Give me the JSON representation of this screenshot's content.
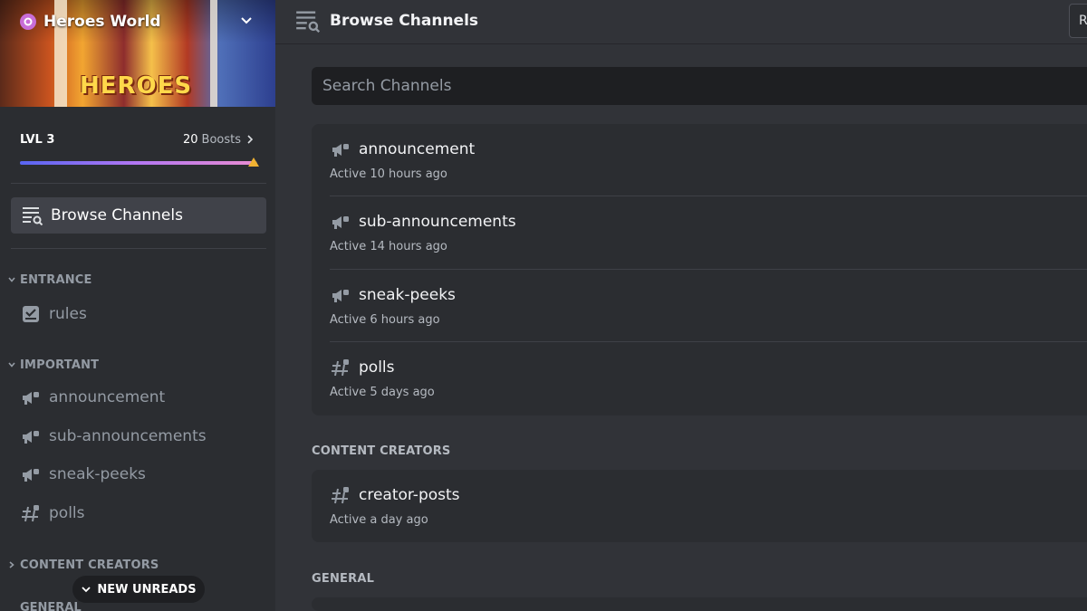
{
  "server": {
    "name": "Heroes World",
    "banner_text": "HEROES",
    "level": "LVL 3",
    "boost_count": "20",
    "boost_label": "Boosts",
    "boost_progress": 0.98
  },
  "sidebar": {
    "browse_label": "Browse Channels",
    "categories": [
      {
        "name": "ENTRANCE",
        "channels": [
          {
            "name": "rules",
            "icon": "rules-icon"
          }
        ]
      },
      {
        "name": "IMPORTANT",
        "channels": [
          {
            "name": "announcement",
            "icon": "announcement-icon"
          },
          {
            "name": "sub-announcements",
            "icon": "announcement-icon"
          },
          {
            "name": "sneak-peeks",
            "icon": "announcement-icon"
          },
          {
            "name": "polls",
            "icon": "hashtag-icon"
          }
        ]
      },
      {
        "name": "CONTENT CREATORS",
        "channels": []
      }
    ],
    "new_unreads": "NEW UNREADS",
    "cut_category": "GENERAL"
  },
  "main": {
    "title": "Browse Channels",
    "right_button": "R",
    "search_placeholder": "Search Channels",
    "groups": [
      {
        "category": "",
        "channels": [
          {
            "name": "announcement",
            "activity": "Active 10 hours ago",
            "icon": "announcement-icon"
          },
          {
            "name": "sub-announcements",
            "activity": "Active 14 hours ago",
            "icon": "announcement-icon"
          },
          {
            "name": "sneak-peeks",
            "activity": "Active 6 hours ago",
            "icon": "announcement-icon"
          },
          {
            "name": "polls",
            "activity": "Active 5 days ago",
            "icon": "hashtag-icon"
          }
        ]
      },
      {
        "category": "CONTENT CREATORS",
        "channels": [
          {
            "name": "creator-posts",
            "activity": "Active a day ago",
            "icon": "hashtag-icon"
          }
        ]
      },
      {
        "category": "GENERAL",
        "channels": []
      }
    ]
  },
  "colors": {
    "accent": "#5865f2",
    "background": "#313338",
    "sidebar": "#2b2d31",
    "selected": "#404249"
  }
}
